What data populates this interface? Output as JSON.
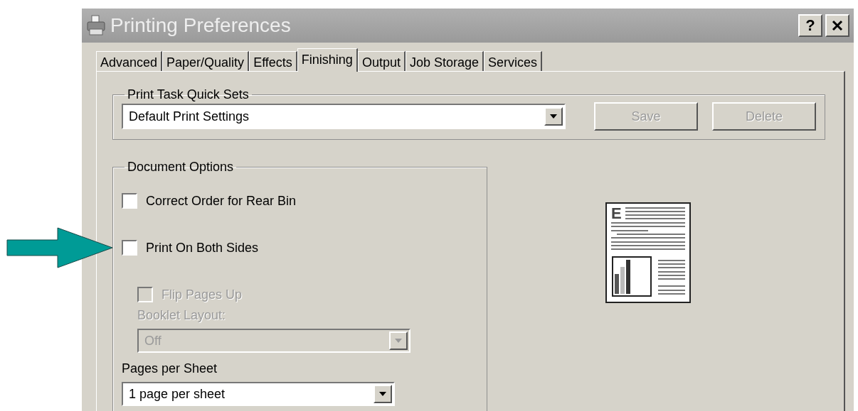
{
  "window": {
    "title": "Printing Preferences",
    "help_button": "?"
  },
  "tabs": [
    {
      "label": "Advanced",
      "selected": false
    },
    {
      "label": "Paper/Quality",
      "selected": false
    },
    {
      "label": "Effects",
      "selected": false
    },
    {
      "label": "Finishing",
      "selected": true
    },
    {
      "label": "Output",
      "selected": false
    },
    {
      "label": "Job Storage",
      "selected": false
    },
    {
      "label": "Services",
      "selected": false
    }
  ],
  "quick_sets": {
    "title": "Print Task Quick Sets",
    "value": "Default Print Settings",
    "buttons": [
      {
        "label": "Save",
        "disabled": true
      },
      {
        "label": "Delete",
        "disabled": true
      }
    ]
  },
  "document_options": {
    "title": "Document Options",
    "items": [
      {
        "kind": "checkbox",
        "label": "Correct Order for Rear Bin",
        "checked": false,
        "disabled": false
      },
      {
        "kind": "checkbox",
        "label": "Print On Both Sides",
        "checked": false,
        "disabled": false,
        "annotated": true
      },
      {
        "kind": "checkbox",
        "label": "Flip Pages Up",
        "checked": false,
        "disabled": true
      },
      {
        "kind": "select",
        "label": "Booklet Layout:",
        "value": "Off",
        "disabled": true
      },
      {
        "kind": "select",
        "label": "Pages per Sheet",
        "value": "1 page per sheet",
        "disabled": false
      }
    ]
  },
  "preview": {
    "letter": "E"
  }
}
